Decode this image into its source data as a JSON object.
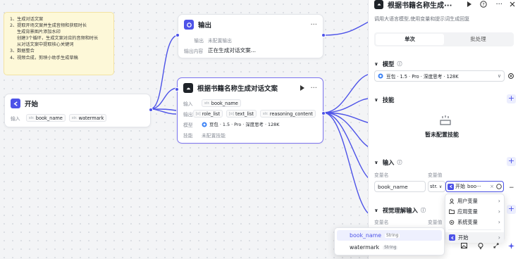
{
  "note": {
    "lines": [
      "1、生成对话文案",
      "2、提取开场文案并生成音频和获取时长",
      "   生成背景图片添加水印",
      "   创建3个循环，生成文案对应的音频和时长",
      "   从对话文案中提取核心关键词",
      "3、数据整合",
      "4、视频合成，剪映小助手生成草稿"
    ]
  },
  "start_node": {
    "title": "开始",
    "input_label": "输入",
    "params": [
      "book_name",
      "watermark"
    ],
    "type_tag": "str."
  },
  "output_node": {
    "title": "输出",
    "more": "···",
    "output_label": "输出",
    "output_value": "未配置输出",
    "content_label": "输出内容",
    "content_value": "正在生成对话文案..."
  },
  "llm_node": {
    "title": "根据书籍名称生成对话文案",
    "more": "···",
    "input_label": "输入",
    "input_param": "book_name",
    "output_label": "输出",
    "outputs": [
      "role_list",
      "text_list",
      "reasoning_content"
    ],
    "output_tags": [
      "[o]",
      "[o]",
      "str."
    ],
    "model_label": "模型",
    "model_value": "豆包 · 1.5 · Pro · 深度思考 · 128K",
    "skill_label": "技能",
    "skill_value": "未配置技能"
  },
  "panel": {
    "title": "根据书籍名称生成···",
    "subtitle": "调用大语言模型,使用变量和提示词生成回复",
    "tabs": [
      "单次",
      "批处理"
    ],
    "active_tab": 0,
    "model_section": "模型",
    "model_value": "豆包 · 1.5 · Pro · 深度思考 · 128K",
    "skills_section": "技能",
    "skills_empty": "暂未配置技能",
    "input_section": "输入",
    "var_name_header": "变量名",
    "var_value_header": "变量值",
    "var_name": "book_name",
    "var_type": "str.",
    "var_ref_node": "开始",
    "var_ref_value": "boo···",
    "vision_section": "视觉理解输入",
    "vision_var_name": "变量名",
    "vision_var_value": "变量值"
  },
  "var_menu": {
    "items": [
      "用户变量",
      "应用变量",
      "系统变量",
      "开始"
    ]
  },
  "start_submenu": {
    "items": [
      {
        "name": "book_name",
        "type": "String"
      },
      {
        "name": "watermark",
        "type": "String"
      }
    ]
  },
  "colors": {
    "accent": "#4d53e8",
    "node_selected": "#7b73f0",
    "note_bg": "#fdf8d8"
  }
}
